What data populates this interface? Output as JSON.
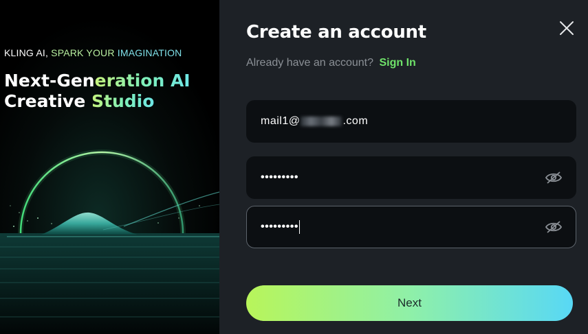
{
  "hero": {
    "tagline_part1": "KLING AI,",
    "tagline_part2": "SPARK YOUR",
    "tagline_part3": "IMAGINATION",
    "headline_line1_a": "Next-Gen",
    "headline_line1_b": "eration AI",
    "headline_line2_a": "Creative",
    "headline_line2_b": "Studio"
  },
  "form": {
    "title": "Create an account",
    "subtitle": "Already have an account?",
    "signin_link": "Sign In",
    "email_prefix": "mail1@",
    "email_suffix": ".com",
    "password_mask": "•••••••••",
    "confirm_mask": "•••••••••",
    "next_label": "Next"
  },
  "icons": {
    "close": "close-icon",
    "eye": "eye-icon"
  },
  "colors": {
    "accent_green": "#6fe26a",
    "button_gradient_start": "#b8f55a",
    "button_gradient_end": "#58d8f5",
    "panel_bg": "#1d2126",
    "field_bg": "#0c0f12"
  }
}
